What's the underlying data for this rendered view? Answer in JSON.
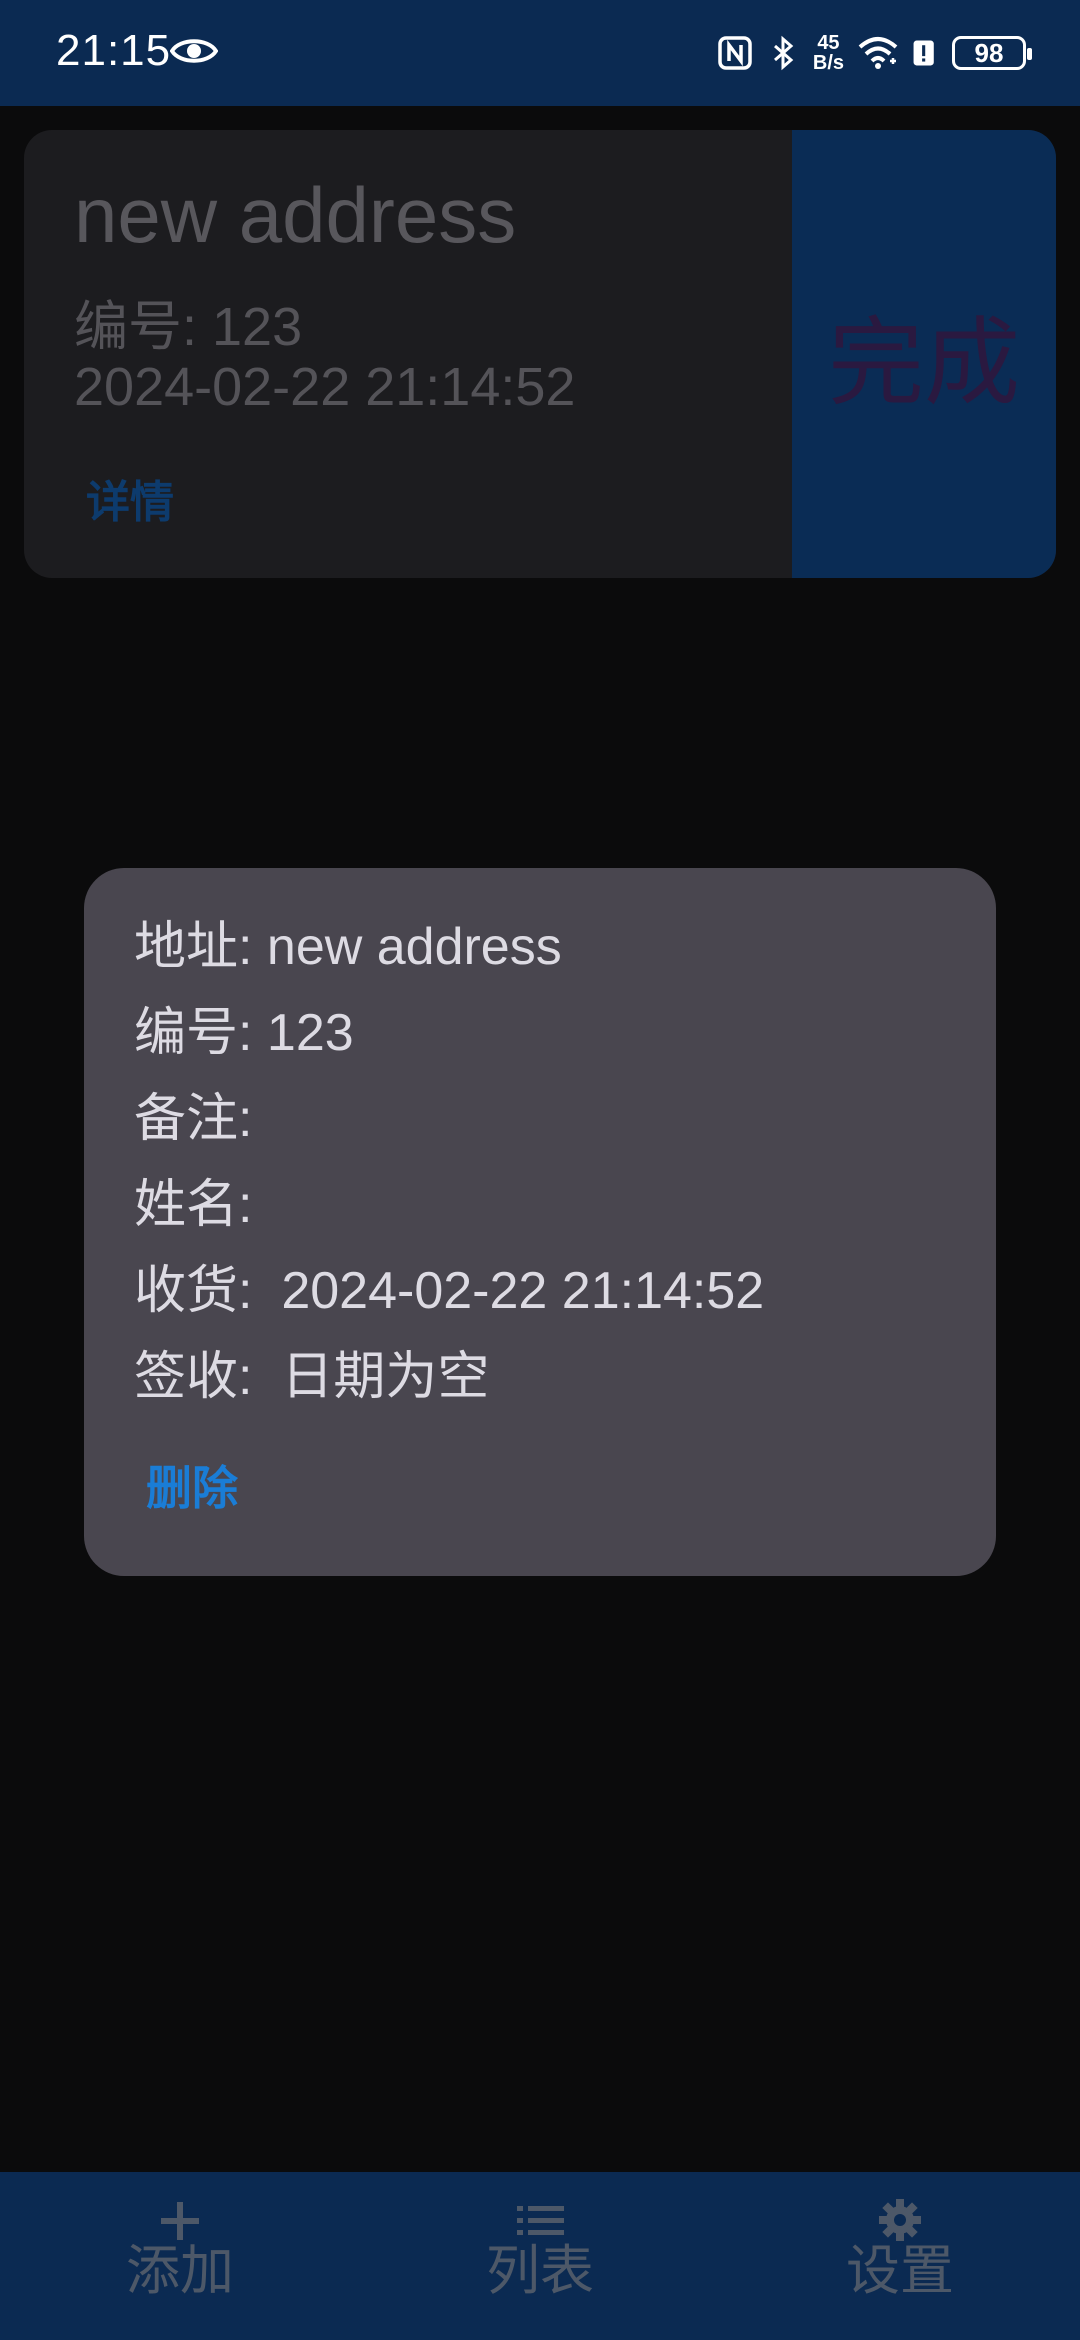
{
  "status_bar": {
    "time": "21:15",
    "net_speed_value": "45",
    "net_speed_unit": "B/s",
    "battery_level": "98",
    "icons": [
      "eye-icon",
      "nfc-icon",
      "bluetooth-icon",
      "wifi-icon",
      "alert-icon",
      "battery-icon"
    ]
  },
  "record_card": {
    "title": "new address",
    "number": "编号: 123",
    "date": "2024-02-22 21:14:52",
    "detail_link": "详情",
    "complete_label": "完成"
  },
  "dialog": {
    "address": "地址: new address",
    "number": "编号: 123",
    "note": "备注:",
    "name": "姓名:",
    "received": "收货:  2024-02-22 21:14:52",
    "signed": "签收:  日期为空",
    "delete_button": "删除"
  },
  "bottom_nav": {
    "items": [
      {
        "label": "添加",
        "icon": "plus-icon"
      },
      {
        "label": "列表",
        "icon": "list-icon"
      },
      {
        "label": "设置",
        "icon": "gear-icon"
      }
    ]
  },
  "colors": {
    "background": "#0b0b0c",
    "bar": "#0b2a52",
    "card": "#1c1c1f",
    "dialog": "#49464f",
    "accent": "#1a7dd6"
  }
}
